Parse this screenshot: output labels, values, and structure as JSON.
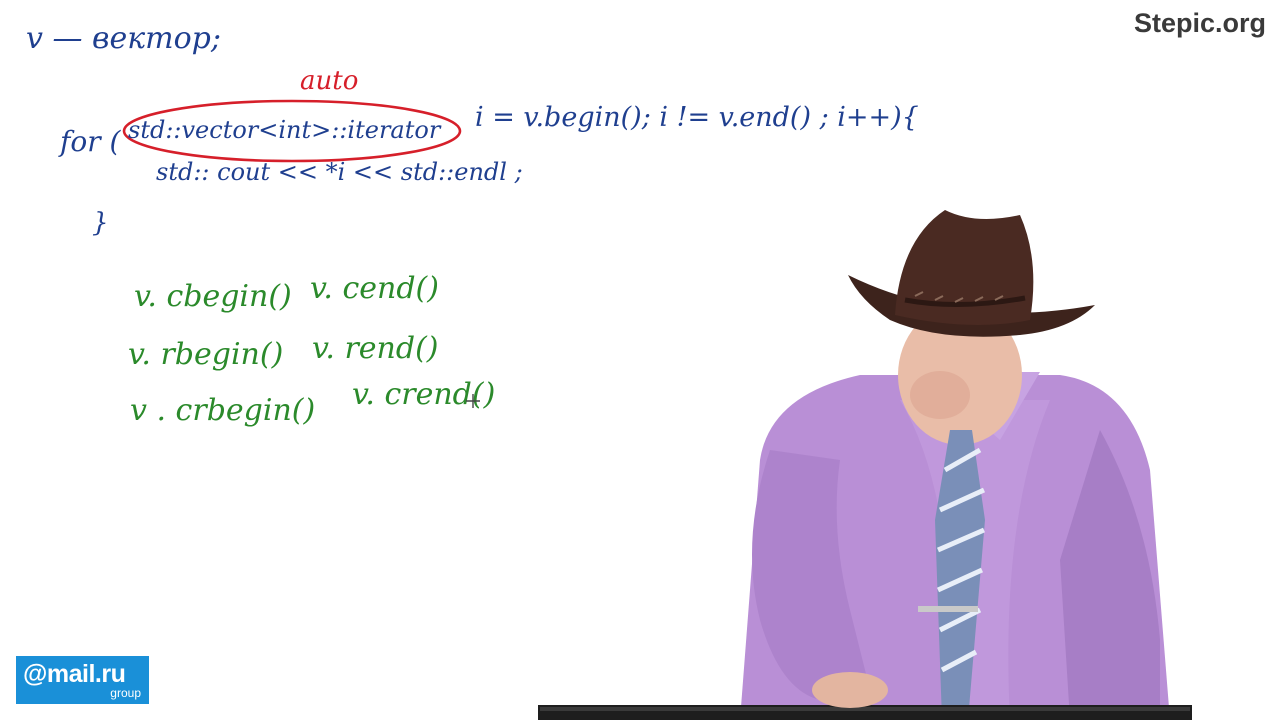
{
  "board": {
    "line1": "v — вектор;",
    "annotation": "auto",
    "loop": {
      "for_kw": "for (",
      "type": "std::vector<int>::iterator",
      "rest": "i = v.begin();  i != v.end() ; i++){",
      "body": "std:: cout  <<   *i   <<   std::endl ;",
      "close": "}"
    },
    "methods": [
      [
        "v. cbegin()",
        "v. cend()"
      ],
      [
        "v. rbegin()",
        "v. rend()"
      ],
      [
        "v . crbegin()",
        "v. crend()"
      ]
    ]
  },
  "watermark": "Stepic.org",
  "logo": {
    "main": "@mail.ru",
    "sub": "group"
  },
  "colors": {
    "ink_blue": "#1f3f8f",
    "ink_green": "#2b8a2b",
    "ink_red": "#d61f2a",
    "shirt": "#b98fd6",
    "hat": "#4a2a22",
    "tie": "#7a8fb8",
    "keyboard": "#1e1e1e",
    "logo_bg": "#1a90d8"
  }
}
